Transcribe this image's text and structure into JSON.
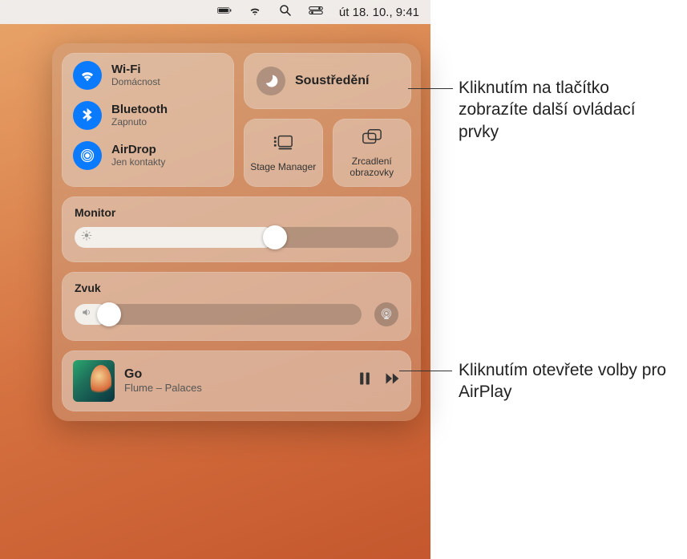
{
  "menubar": {
    "datetime": "út 18. 10.,  9:41"
  },
  "connectivity": {
    "wifi": {
      "title": "Wi-Fi",
      "sub": "Domácnost"
    },
    "bluetooth": {
      "title": "Bluetooth",
      "sub": "Zapnuto"
    },
    "airdrop": {
      "title": "AirDrop",
      "sub": "Jen kontakty"
    }
  },
  "focus": {
    "label": "Soustředění"
  },
  "stage_manager": {
    "label": "Stage Manager"
  },
  "screen_mirroring": {
    "label": "Zrcadlení obrazovky"
  },
  "display": {
    "title": "Monitor",
    "value_pct": 62
  },
  "sound": {
    "title": "Zvuk",
    "value_pct": 12
  },
  "now_playing": {
    "title": "Go",
    "subtitle": "Flume – Palaces"
  },
  "callouts": {
    "focus_hint": "Kliknutím na tlačítko zobrazíte další ovládací prvky",
    "airplay_hint": "Kliknutím otevřete volby pro AirPlay"
  },
  "chart_data": null
}
